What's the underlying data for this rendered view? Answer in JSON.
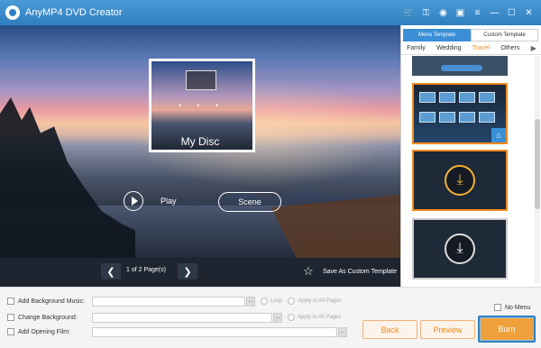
{
  "window": {
    "title": "AnyMP4 DVD Creator",
    "title_icons": [
      "cart-icon",
      "key-icon",
      "register-icon",
      "chat-icon",
      "menu-icon",
      "minimize-icon",
      "maximize-icon",
      "close-icon"
    ],
    "title_glyphs": [
      "🛒",
      "⚿",
      "◉",
      "▣",
      "≡",
      "—",
      "☐",
      "✕"
    ]
  },
  "preview": {
    "disc_title": "My Disc",
    "play_label": "Play",
    "scene_label": "Scene"
  },
  "pager": {
    "prev_glyph": "❮",
    "next_glyph": "❯",
    "page_label": "1 of 2 Page(s)",
    "save_template_label": "Save As Custom Template"
  },
  "template_panel": {
    "tabs": [
      {
        "label": "Menu Template",
        "active": true
      },
      {
        "label": "Custom Template",
        "active": false
      }
    ],
    "categories": [
      {
        "label": "Family",
        "active": false
      },
      {
        "label": "Wedding",
        "active": false
      },
      {
        "label": "Travel",
        "active": true
      },
      {
        "label": "Others",
        "active": false
      }
    ],
    "category_next_glyph": "▶",
    "download_glyph": "⤓",
    "home_glyph": "⌂"
  },
  "options": {
    "background_music": {
      "label": "Add Background Music:",
      "value": "",
      "browse": "...",
      "loop": "Loop",
      "apply_all": "Apply to All Pages"
    },
    "background": {
      "label": "Change Background:",
      "value": "",
      "browse": "...",
      "apply_all": "Apply to All Pages"
    },
    "opening_film": {
      "label": "Add Opening Film:",
      "value": "",
      "browse": "..."
    },
    "no_menu": "No Menu"
  },
  "buttons": {
    "back": "Back",
    "preview": "Preview",
    "burn": "Burn"
  },
  "colors": {
    "accent": "#f08a20",
    "titlebar": "#2f7fc0",
    "selected_tab": "#3a8fd6"
  }
}
